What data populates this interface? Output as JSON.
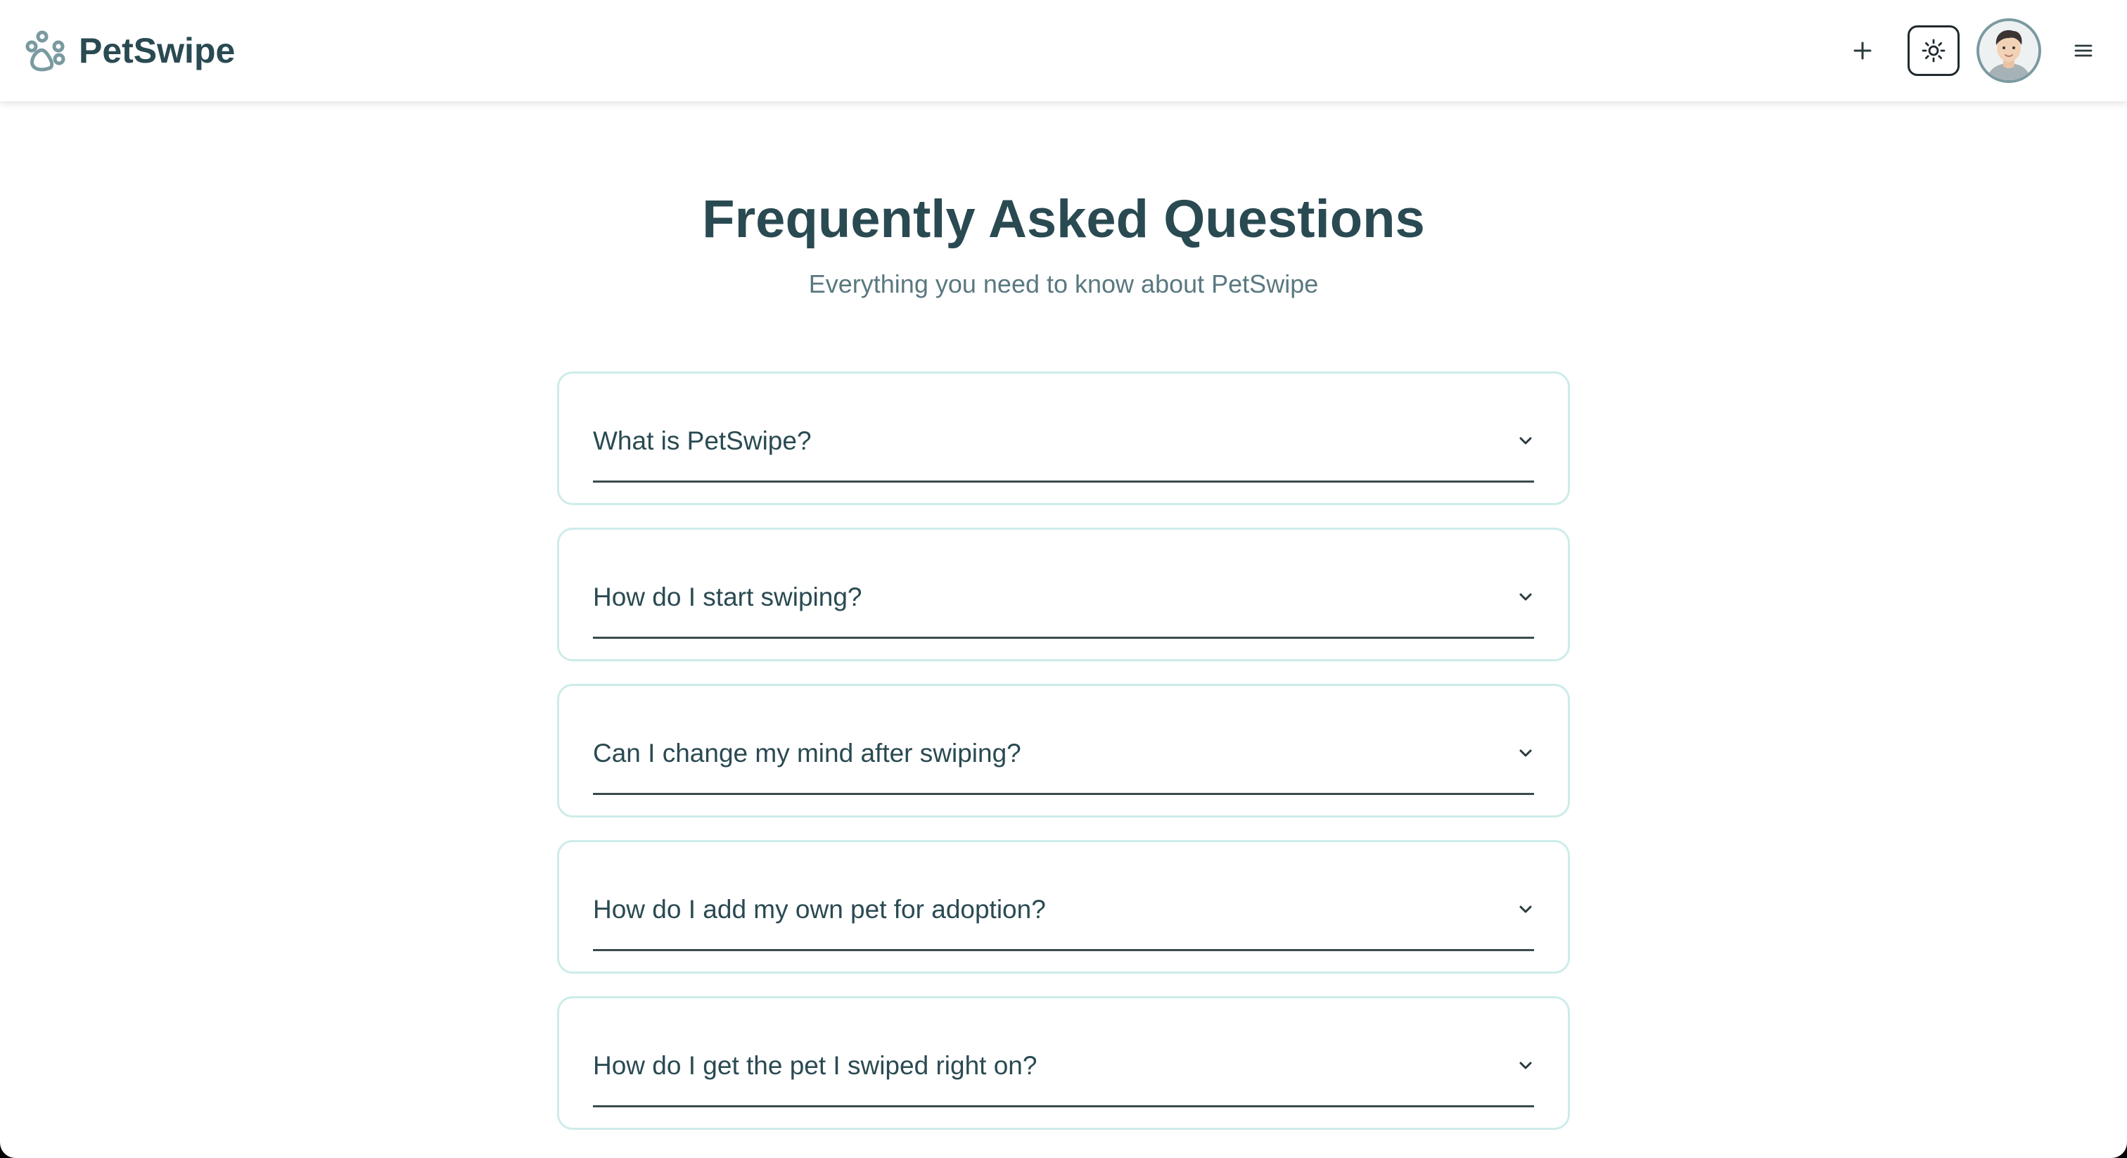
{
  "app": {
    "name": "PetSwipe"
  },
  "header": {
    "icons": {
      "logo": "paw-icon",
      "add": "plus-icon",
      "theme": "sun-icon",
      "avatar": "user-avatar",
      "menu": "hamburger-menu-icon"
    }
  },
  "main": {
    "title": "Frequently Asked Questions",
    "subtitle": "Everything you need to know about PetSwipe",
    "faq": [
      {
        "question": "What is PetSwipe?"
      },
      {
        "question": "How do I start swiping?"
      },
      {
        "question": "Can I change my mind after swiping?"
      },
      {
        "question": "How do I add my own pet for adoption?"
      },
      {
        "question": "How do I get the pet I swiped right on?"
      }
    ]
  },
  "colors": {
    "brand_text": "#2a4a52",
    "subtitle_text": "#5a7880",
    "card_border": "#cdecea",
    "divider": "#3a4a4e"
  }
}
